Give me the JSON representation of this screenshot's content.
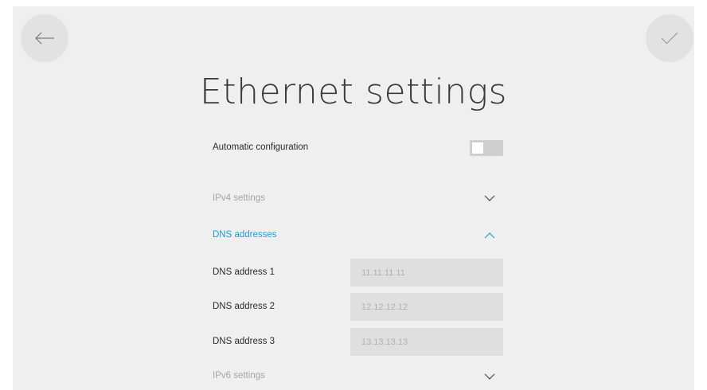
{
  "header": {
    "title": "Ethernet settings"
  },
  "automatic_configuration": {
    "label": "Automatic configuration",
    "enabled": false
  },
  "sections": {
    "ipv4": {
      "label": "IPv4 settings",
      "expanded": false
    },
    "dns": {
      "label": "DNS addresses",
      "expanded": true
    },
    "ipv6": {
      "label": "IPv6 settings",
      "expanded": false
    }
  },
  "dns_fields": [
    {
      "label": "DNS address 1",
      "placeholder": "11.11.11.11"
    },
    {
      "label": "DNS address 2",
      "placeholder": "12.12.12.12"
    },
    {
      "label": "DNS address 3",
      "placeholder": "13.13.13.13"
    }
  ],
  "colors": {
    "accent": "#1aa1d3",
    "background": "#efefef",
    "field": "#dfdfdf",
    "button": "#e2e2e2"
  },
  "icons": {
    "back": "arrow-left-icon",
    "confirm": "checkmark-icon",
    "collapse": "chevron-up-icon",
    "expand": "chevron-down-icon"
  }
}
